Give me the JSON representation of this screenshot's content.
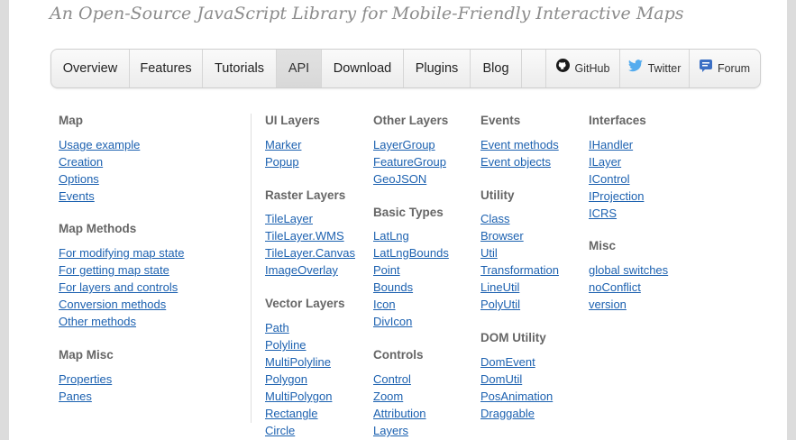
{
  "tagline": "An Open-Source JavaScript Library for Mobile-Friendly Interactive Maps",
  "nav": {
    "overview": "Overview",
    "features": "Features",
    "tutorials": "Tutorials",
    "api": "API",
    "download": "Download",
    "plugins": "Plugins",
    "blog": "Blog",
    "github": "GitHub",
    "twitter": "Twitter",
    "forum": "Forum"
  },
  "colors": {
    "link": "#1c61b0",
    "heading": "#666666",
    "tagline": "#8c8c8c",
    "twitter": "#55acee",
    "forum": "#3b6fc4"
  },
  "icons": {
    "github": "github-icon",
    "twitter": "twitter-icon",
    "forum": "forum-icon"
  },
  "sections": {
    "map": {
      "title": "Map",
      "links": [
        "Usage example",
        "Creation",
        "Options",
        "Events"
      ]
    },
    "map_methods": {
      "title": "Map Methods",
      "links": [
        "For modifying map state",
        "For getting map state",
        "For layers and controls",
        "Conversion methods",
        "Other methods"
      ]
    },
    "map_misc": {
      "title": "Map Misc",
      "links": [
        "Properties",
        "Panes"
      ]
    },
    "ui_layers": {
      "title": "UI Layers",
      "links": [
        "Marker",
        "Popup"
      ]
    },
    "raster_layers": {
      "title": "Raster Layers",
      "links": [
        "TileLayer",
        "TileLayer.WMS",
        "TileLayer.Canvas",
        "ImageOverlay"
      ]
    },
    "vector_layers": {
      "title": "Vector Layers",
      "links": [
        "Path",
        "Polyline",
        "MultiPolyline",
        "Polygon",
        "MultiPolygon",
        "Rectangle",
        "Circle"
      ]
    },
    "other_layers": {
      "title": "Other Layers",
      "links": [
        "LayerGroup",
        "FeatureGroup",
        "GeoJSON"
      ]
    },
    "basic_types": {
      "title": "Basic Types",
      "links": [
        "LatLng",
        "LatLngBounds",
        "Point",
        "Bounds",
        "Icon",
        "DivIcon"
      ]
    },
    "controls": {
      "title": "Controls",
      "links": [
        "Control",
        "Zoom",
        "Attribution",
        "Layers"
      ]
    },
    "events": {
      "title": "Events",
      "links": [
        "Event methods",
        "Event objects"
      ]
    },
    "utility": {
      "title": "Utility",
      "links": [
        "Class",
        "Browser",
        "Util",
        "Transformation",
        "LineUtil",
        "PolyUtil"
      ]
    },
    "dom_utility": {
      "title": "DOM Utility",
      "links": [
        "DomEvent",
        "DomUtil",
        "PosAnimation",
        "Draggable"
      ]
    },
    "interfaces": {
      "title": "Interfaces",
      "links": [
        "IHandler",
        "ILayer",
        "IControl",
        "IProjection",
        "ICRS"
      ]
    },
    "misc": {
      "title": "Misc",
      "links": [
        "global switches",
        "noConflict",
        "version"
      ]
    }
  }
}
